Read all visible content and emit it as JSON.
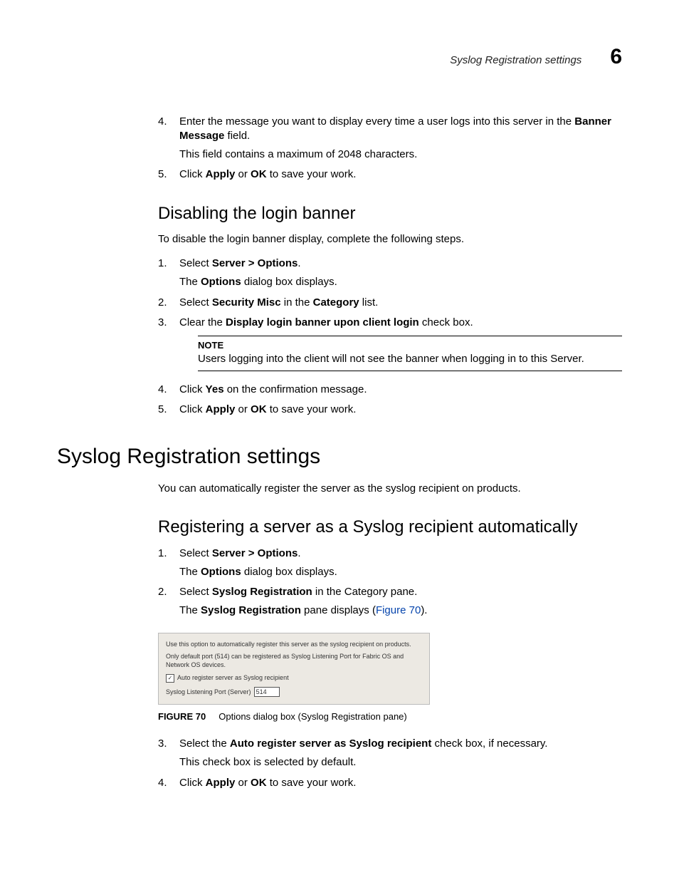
{
  "header": {
    "running_title": "Syslog Registration settings",
    "chapter_number": "6"
  },
  "top_steps": [
    {
      "num": "4.",
      "parts": [
        "Enter the message you want to display every time a user logs into this server in the ",
        "Banner Message",
        " field."
      ],
      "sub": "This field contains a maximum of 2048 characters."
    },
    {
      "num": "5.",
      "parts": [
        "Click ",
        "Apply",
        " or ",
        "OK",
        " to save your work."
      ]
    }
  ],
  "disable_banner": {
    "heading": "Disabling the login banner",
    "intro": "To disable the login banner display, complete the following steps.",
    "steps_a": [
      {
        "num": "1.",
        "parts": [
          "Select ",
          "Server > Options",
          "."
        ],
        "sub_parts": [
          "The ",
          "Options",
          " dialog box displays."
        ]
      },
      {
        "num": "2.",
        "parts": [
          "Select ",
          "Security Misc",
          " in the ",
          "Category",
          " list."
        ]
      },
      {
        "num": "3.",
        "parts": [
          "Clear the ",
          "Display login banner upon client login",
          " check box."
        ]
      }
    ],
    "note": {
      "title": "NOTE",
      "body": "Users logging into the client will not see the banner when logging in to this Server."
    },
    "steps_b": [
      {
        "num": "4.",
        "parts": [
          "Click ",
          "Yes",
          " on the confirmation message."
        ]
      },
      {
        "num": "5.",
        "parts": [
          "Click ",
          "Apply",
          " or ",
          "OK",
          " to save your work."
        ]
      }
    ]
  },
  "syslog": {
    "chapter_heading": "Syslog Registration settings",
    "intro": "You can automatically register the server as the syslog recipient on products.",
    "sub_heading": "Registering a server as a Syslog recipient automatically",
    "steps_pre": [
      {
        "num": "1.",
        "parts": [
          "Select ",
          "Server > Options",
          "."
        ],
        "sub_parts": [
          "The ",
          "Options",
          " dialog box displays."
        ]
      },
      {
        "num": "2.",
        "parts": [
          "Select ",
          "Syslog Registration",
          " in the Category pane."
        ],
        "sub_parts": [
          "The ",
          "Syslog Registration",
          " pane displays (",
          "Figure 70",
          ")."
        ],
        "sub_link_index": 3
      }
    ],
    "figure": {
      "line1": "Use this option to automatically register this server as the syslog recipient on products.",
      "line2": "Only default port (514) can be registered as Syslog Listening Port for Fabric OS and Network OS devices.",
      "checkbox_label": "Auto register server as Syslog recipient",
      "checkbox_checked": "✓",
      "port_label": "Syslog Listening Port (Server)",
      "port_value": "514"
    },
    "figure_caption": {
      "label": "FIGURE 70",
      "text": "Options dialog box (Syslog Registration pane)"
    },
    "steps_post": [
      {
        "num": "3.",
        "parts": [
          "Select the ",
          "Auto register server as Syslog recipient",
          " check box, if necessary."
        ],
        "sub": "This check box is selected by default."
      },
      {
        "num": "4.",
        "parts": [
          "Click ",
          "Apply",
          " or ",
          "OK",
          " to save your work."
        ]
      }
    ]
  }
}
